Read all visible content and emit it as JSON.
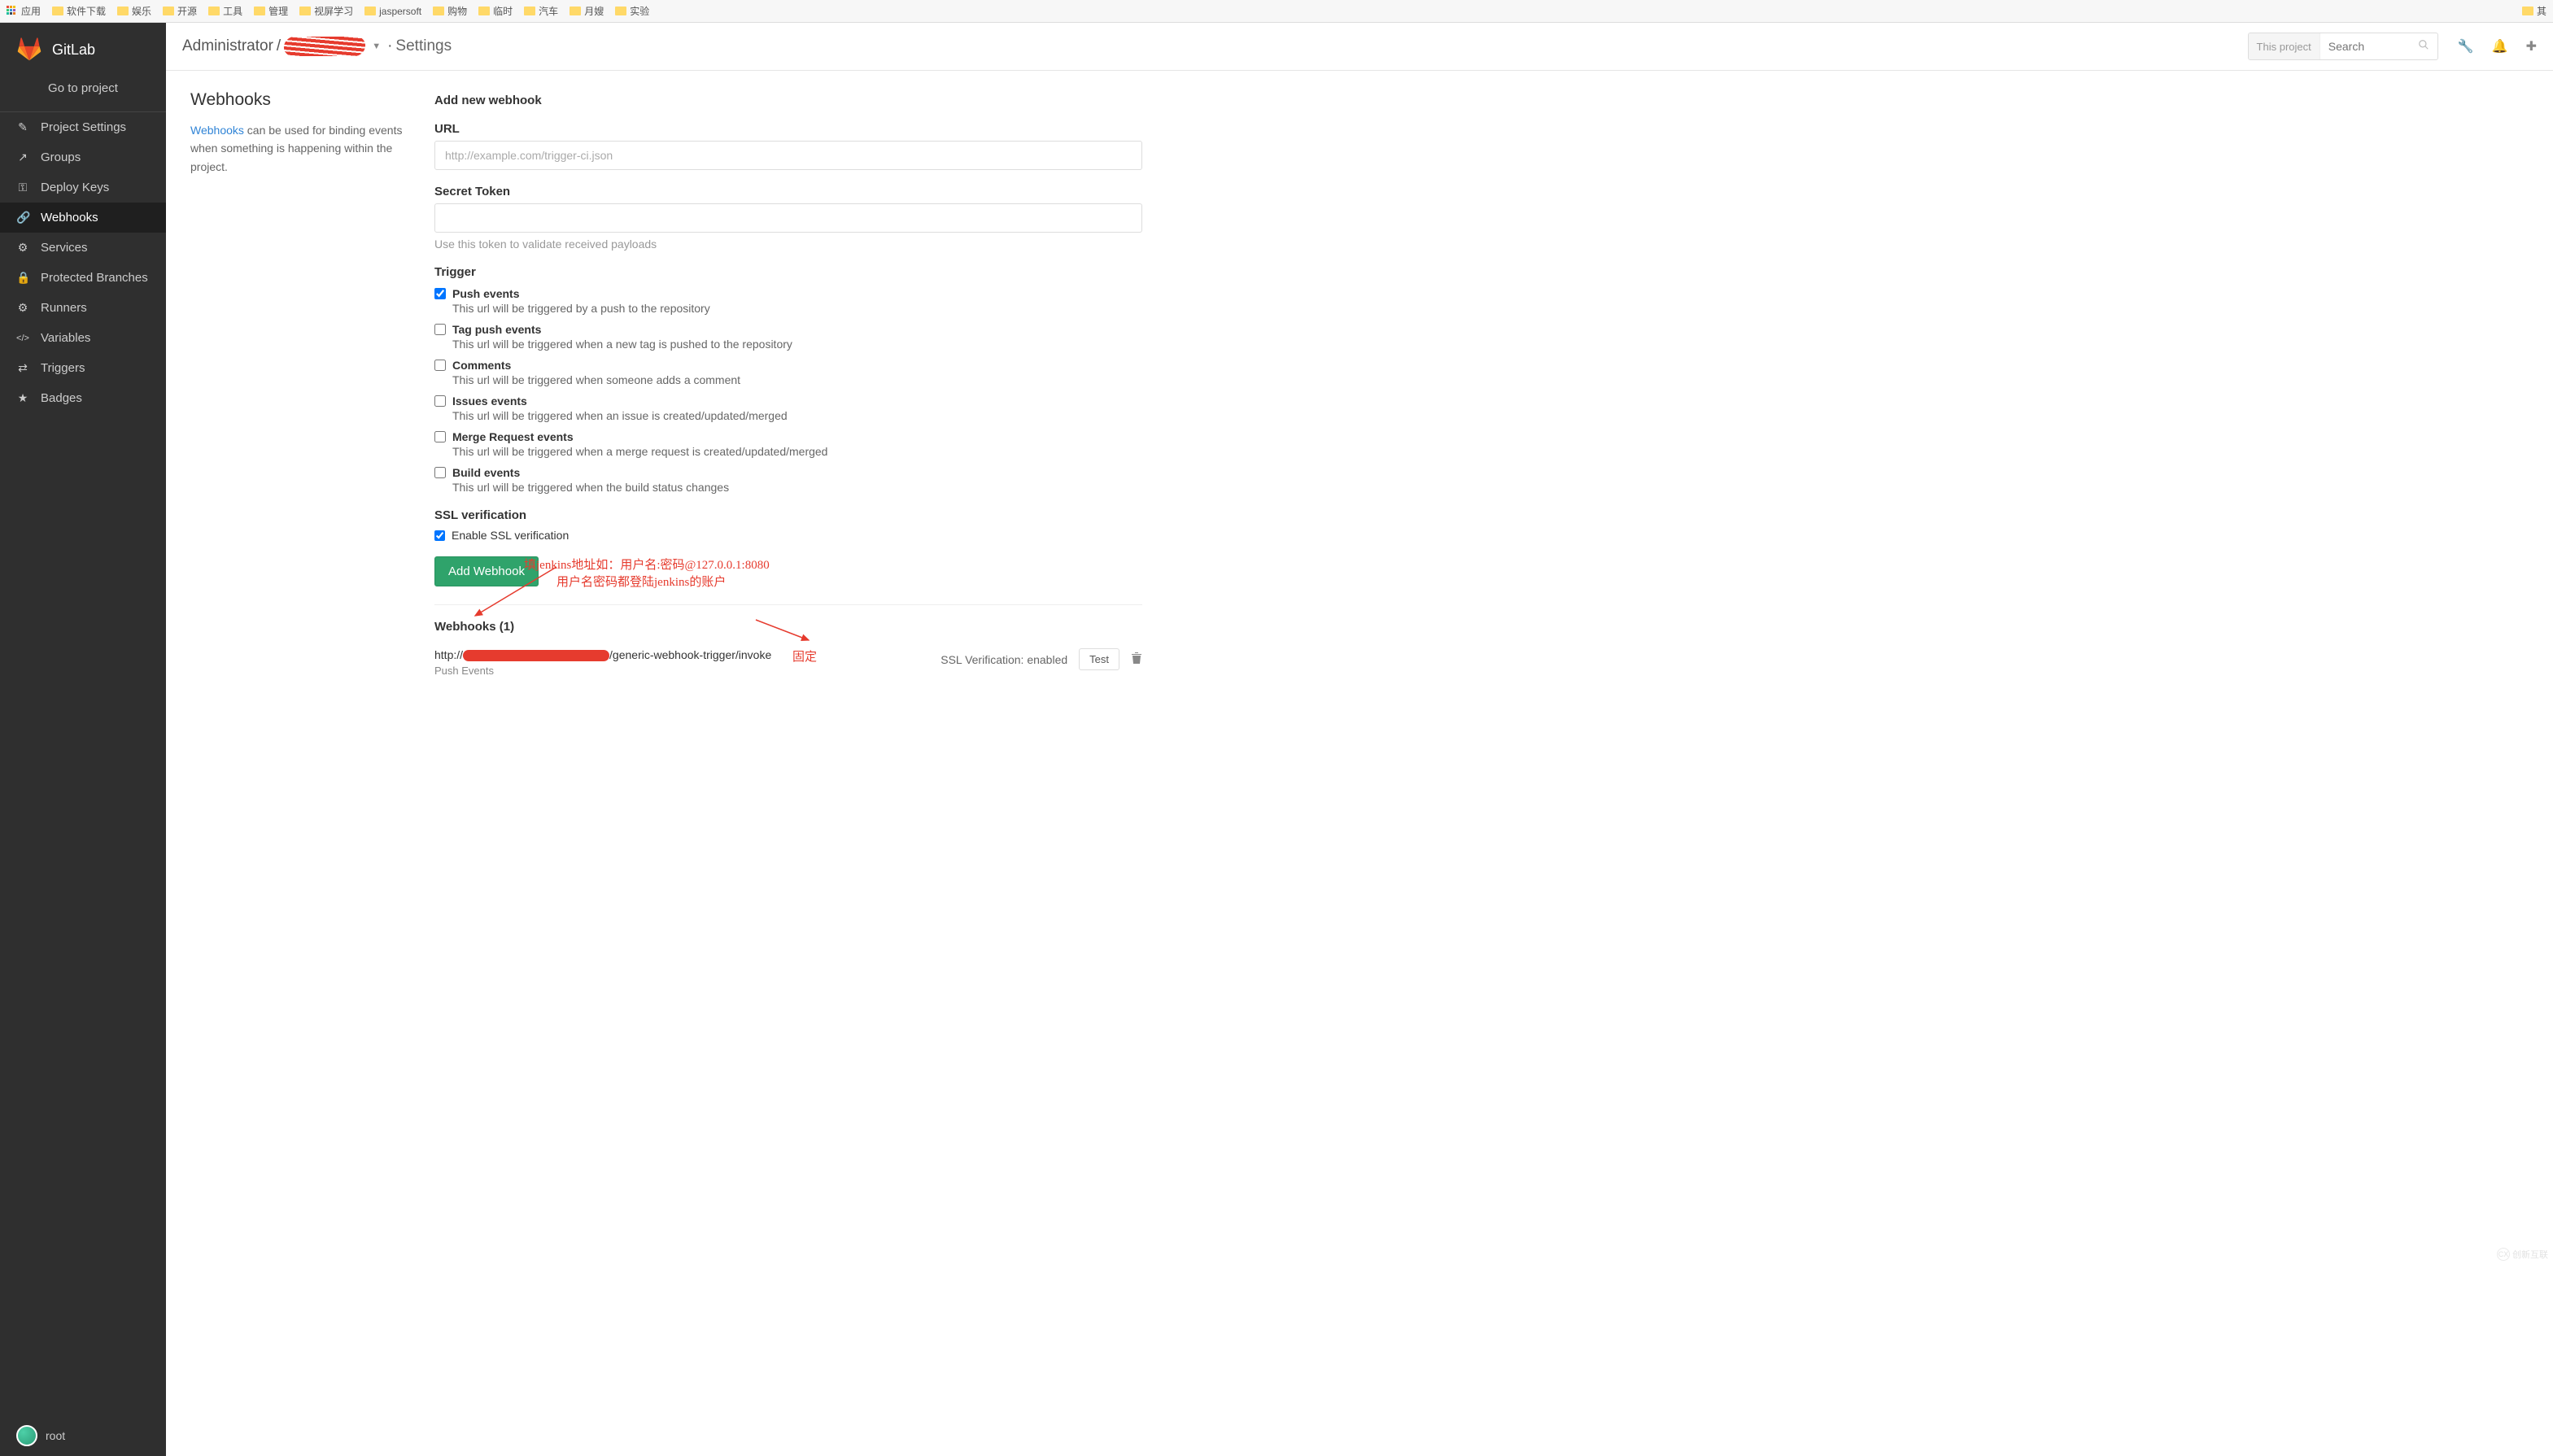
{
  "bookmarks": {
    "apps": "应用",
    "items": [
      "软件下载",
      "娱乐",
      "开源",
      "工具",
      "管理",
      "视屏学习",
      "jaspersoft",
      "购物",
      "临时",
      "汽车",
      "月嫂",
      "实验"
    ],
    "right": "其"
  },
  "sidebar": {
    "brand": "GitLab",
    "go_to_project": "Go to project",
    "items": [
      {
        "label": "Project Settings",
        "icon": "✎"
      },
      {
        "label": "Groups",
        "icon": "↗"
      },
      {
        "label": "Deploy Keys",
        "icon": "🔑"
      },
      {
        "label": "Webhooks",
        "icon": "🔗"
      },
      {
        "label": "Services",
        "icon": "⚙"
      },
      {
        "label": "Protected Branches",
        "icon": "🔒"
      },
      {
        "label": "Runners",
        "icon": "⚙"
      },
      {
        "label": "Variables",
        "icon": "</>"
      },
      {
        "label": "Triggers",
        "icon": "⇄"
      },
      {
        "label": "Badges",
        "icon": "★"
      }
    ],
    "user": "root"
  },
  "header": {
    "admin": "Administrator",
    "sep": "/",
    "dot": "·",
    "settings": "Settings",
    "search_badge": "This project",
    "search_placeholder": "Search"
  },
  "left": {
    "title": "Webhooks",
    "link": "Webhooks",
    "desc_rest": " can be used for binding events when something is happening within the project."
  },
  "form": {
    "add_title": "Add new webhook",
    "url_label": "URL",
    "url_placeholder": "http://example.com/trigger-ci.json",
    "secret_label": "Secret Token",
    "secret_hint": "Use this token to validate received payloads",
    "trigger_label": "Trigger",
    "triggers": [
      {
        "t": "Push events",
        "d": "This url will be triggered by a push to the repository",
        "c": true
      },
      {
        "t": "Tag push events",
        "d": "This url will be triggered when a new tag is pushed to the repository",
        "c": false
      },
      {
        "t": "Comments",
        "d": "This url will be triggered when someone adds a comment",
        "c": false
      },
      {
        "t": "Issues events",
        "d": "This url will be triggered when an issue is created/updated/merged",
        "c": false
      },
      {
        "t": "Merge Request events",
        "d": "This url will be triggered when a merge request is created/updated/merged",
        "c": false
      },
      {
        "t": "Build events",
        "d": "This url will be triggered when the build status changes",
        "c": false
      }
    ],
    "ssl_section": "SSL verification",
    "ssl_enable": "Enable SSL verification",
    "submit": "Add Webhook"
  },
  "webhooks": {
    "count_label": "Webhooks (1)",
    "url_prefix": "http://",
    "url_suffix": "/generic-webhook-trigger/invoke",
    "tag": "Push Events",
    "ssl_status": "SSL Verification: enabled",
    "test": "Test"
  },
  "annotations": {
    "line1": "填jenkins地址如：用户名:密码@127.0.0.1:8080",
    "line2": "用户名密码都登陆jenkins的账户",
    "fixed": "固定"
  },
  "watermark": "创新互联"
}
